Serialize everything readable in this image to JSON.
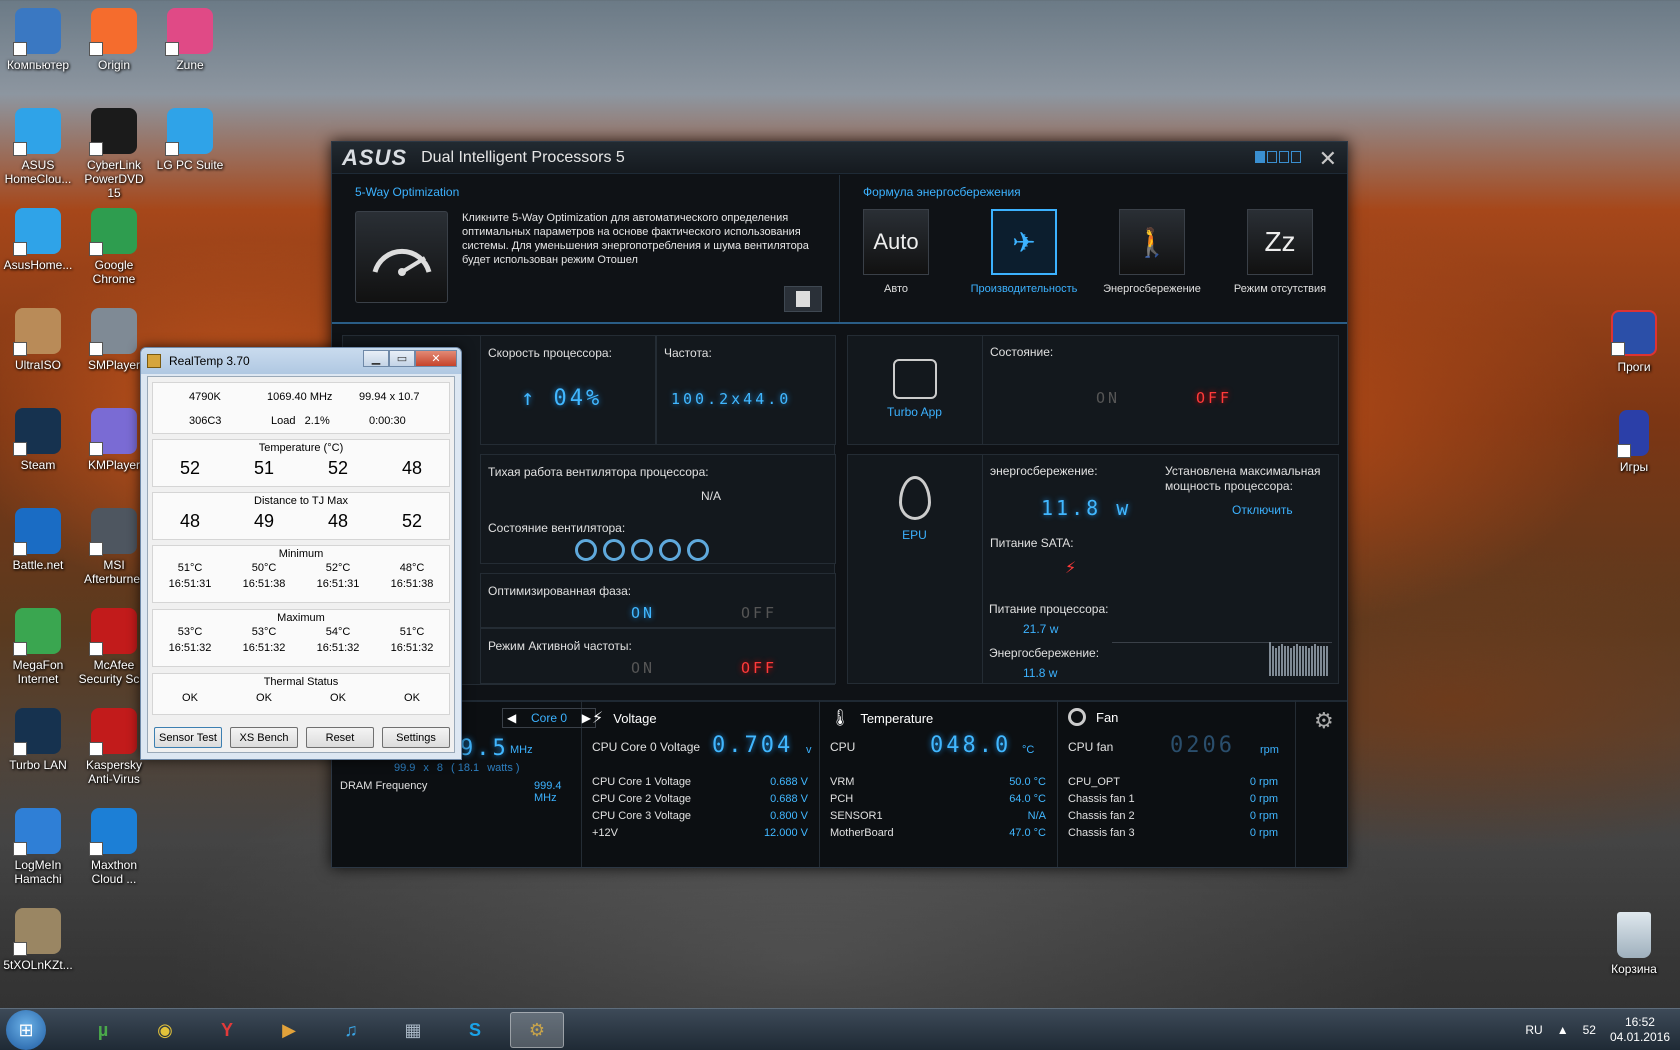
{
  "desktop_left": [
    {
      "label": "Компьютер",
      "icon": "computer-icon",
      "color": "#3a78c2"
    },
    {
      "label": "Origin",
      "icon": "origin-icon",
      "color": "#f56c2d"
    },
    {
      "label": "Zune",
      "icon": "zune-icon",
      "color": "#e04a86"
    },
    {
      "label": "ASUS HomeClou...",
      "icon": "cloud-icon",
      "color": "#2fa3e8"
    },
    {
      "label": "CyberLink PowerDVD 15",
      "icon": "powerdvd-icon",
      "color": "#1b1b1b"
    },
    {
      "label": "LG PC Suite",
      "icon": "lg-icon",
      "color": "#2fa3e8"
    },
    {
      "label": "AsusHome...",
      "icon": "cloud-icon",
      "color": "#2fa3e8"
    },
    {
      "label": "Google Chrome",
      "icon": "chrome-icon",
      "color": "#2e9d4f"
    },
    {
      "label": "UltraISO",
      "icon": "disc-icon",
      "color": "#b98b58"
    },
    {
      "label": "SMPlayer",
      "icon": "film-icon",
      "color": "#7f8a95"
    },
    {
      "label": "Steam",
      "icon": "steam-icon",
      "color": "#16324f"
    },
    {
      "label": "KMPlayer",
      "icon": "play-icon",
      "color": "#7a6bd4"
    },
    {
      "label": "Battle.net",
      "icon": "battlenet-icon",
      "color": "#1a6cc4"
    },
    {
      "label": "MSI Afterburner",
      "icon": "jet-icon",
      "color": "#4e5660"
    },
    {
      "label": "MegaFon Internet",
      "icon": "signal-icon",
      "color": "#3aa650"
    },
    {
      "label": "McAfee Security Sc...",
      "icon": "mcafee-icon",
      "color": "#c21b1b"
    },
    {
      "label": "Turbo LAN",
      "icon": "globe-icon",
      "color": "#16324f"
    },
    {
      "label": "Kaspersky Anti-Virus",
      "icon": "kaspersky-icon",
      "color": "#c21b1b"
    },
    {
      "label": "LogMeIn Hamachi",
      "icon": "hamachi-icon",
      "color": "#2f7fd6"
    },
    {
      "label": "Maxthon Cloud ...",
      "icon": "maxthon-icon",
      "color": "#1c7fd6"
    },
    {
      "label": "5tXOLnKZt...",
      "icon": "image-icon",
      "color": "#9a8663"
    }
  ],
  "desktop_right": [
    {
      "label": "Проги",
      "icon": "folder-icon"
    },
    {
      "label": "Игры",
      "icon": "book-icon"
    },
    {
      "label": "Корзина",
      "icon": "recycle-bin-icon"
    }
  ],
  "asus": {
    "logo": "ASUS",
    "title": "Dual Intelligent Processors 5",
    "five_way": {
      "header": "5-Way Optimization",
      "description": "Кликните 5-Way Optimization для автоматического определения оптимальных параметров на основе фактического использования системы. Для уменьшения энергопотребления и шума вентилятора будет использован режим Отошел"
    },
    "formula": {
      "header": "Формула энергосбережения",
      "modes": [
        {
          "icon_text": "Auto",
          "label": "Авто",
          "active": false
        },
        {
          "icon_text": "✈",
          "label": "Производительность",
          "active": true
        },
        {
          "icon_text": "🚶",
          "label": "Энергосбережение",
          "active": false
        },
        {
          "icon_text": "Zz",
          "label": "Режим отсутствия",
          "active": false
        }
      ]
    },
    "tpu": {
      "cpu_speed_label": "Скорость процессора:",
      "cpu_speed_value": "04%",
      "freq_label": "Частота:",
      "freq_value": "100.2x44.0",
      "fan_quiet_label": "Тихая работа вентилятора процессора:",
      "fan_quiet_value": "N/A",
      "fan_state_label": "Состояние вентилятора:",
      "phase_label": "Оптимизированная фаза:",
      "phase_on": "ON",
      "phase_off": "OFF",
      "active_freq_label": "Режим Активной частоты:",
      "active_on": "ON",
      "active_off": "OFF"
    },
    "turbo_app": {
      "label": "Turbo App",
      "state_label": "Состояние:",
      "on": "ON",
      "off": "OFF"
    },
    "epu": {
      "label": "EPU",
      "saving_label": "энергосбережение:",
      "saving_value": "11.8 w",
      "max_power_label": "Установлена максимальная мощность процессора:",
      "disable_link": "Отключить",
      "sata_label": "Питание SATA:",
      "cpu_power_label": "Питание процессора:",
      "cpu_power_value": "21.7 w",
      "energy_label": "Энергосбережение:",
      "energy_value": "11.8 w"
    },
    "monitor": {
      "core_selector": "Core 0",
      "freq_big": "9.5",
      "freq_unit": "MHz",
      "freq_sub_a": "99.9",
      "freq_sub_x": "x",
      "freq_sub_b": "8",
      "freq_sub_c": "( 18.1",
      "freq_sub_d": "watts )",
      "dram_label": "DRAM Frequency",
      "dram_value": "999.4 MHz",
      "voltage": {
        "title": "Voltage",
        "main_label": "CPU Core 0 Voltage",
        "main_value": "0.704",
        "main_unit": "v",
        "rows": [
          {
            "name": "CPU Core 1 Voltage",
            "value": "0.688",
            "unit": "V"
          },
          {
            "name": "CPU Core 2 Voltage",
            "value": "0.688",
            "unit": "V"
          },
          {
            "name": "CPU Core 3 Voltage",
            "value": "0.800",
            "unit": "V"
          },
          {
            "name": "+12V",
            "value": "12.000",
            "unit": "V"
          }
        ]
      },
      "temperature": {
        "title": "Temperature",
        "main_label": "CPU",
        "main_value": "048.0",
        "main_unit": "°C",
        "rows": [
          {
            "name": "VRM",
            "value": "50.0 °C"
          },
          {
            "name": "PCH",
            "value": "64.0 °C"
          },
          {
            "name": "SENSOR1",
            "value": "N/A"
          },
          {
            "name": "MotherBoard",
            "value": "47.0 °C"
          }
        ]
      },
      "fan": {
        "title": "Fan",
        "main_label": "CPU fan",
        "main_value": "0206",
        "main_unit": "rpm",
        "rows": [
          {
            "name": "CPU_OPT",
            "value": "0",
            "unit": "rpm"
          },
          {
            "name": "Chassis fan 1",
            "value": "0",
            "unit": "rpm"
          },
          {
            "name": "Chassis fan 2",
            "value": "0",
            "unit": "rpm"
          },
          {
            "name": "Chassis fan 3",
            "value": "0",
            "unit": "rpm"
          }
        ]
      }
    }
  },
  "realtemp": {
    "title": "RealTemp 3.70",
    "cpu_model": "4790K",
    "cpu_freq": "1069.40 MHz",
    "multiplier": "99.94 x 10.7",
    "cpuid": "306C3",
    "load_label": "Load",
    "load_value": "2.1%",
    "elapsed": "0:00:30",
    "temp_caption": "Temperature (°C)",
    "temps": [
      "52",
      "51",
      "52",
      "48"
    ],
    "tjmax_caption": "Distance to TJ Max",
    "tjmax": [
      "48",
      "49",
      "48",
      "52"
    ],
    "min_caption": "Minimum",
    "min_temps": [
      "51°C",
      "50°C",
      "52°C",
      "48°C"
    ],
    "min_times": [
      "16:51:31",
      "16:51:38",
      "16:51:31",
      "16:51:38"
    ],
    "max_caption": "Maximum",
    "max_temps": [
      "53°C",
      "53°C",
      "54°C",
      "51°C"
    ],
    "max_times": [
      "16:51:32",
      "16:51:32",
      "16:51:32",
      "16:51:32"
    ],
    "thermal_caption": "Thermal Status",
    "thermal": [
      "OK",
      "OK",
      "OK",
      "OK"
    ],
    "buttons": [
      "Sensor Test",
      "XS Bench",
      "Reset",
      "Settings"
    ]
  },
  "taskbar": {
    "apps": [
      {
        "name": "utorrent",
        "glyph": "µ",
        "color": "#4aa84a"
      },
      {
        "name": "chrome",
        "glyph": "◉",
        "color": "#e2c23a"
      },
      {
        "name": "yandex",
        "glyph": "Y",
        "color": "#e23a3a"
      },
      {
        "name": "media-player",
        "glyph": "▶",
        "color": "#e2a23a"
      },
      {
        "name": "itunes",
        "glyph": "♫",
        "color": "#3aa3e2"
      },
      {
        "name": "calculator",
        "glyph": "▦",
        "color": "#a8b6c4"
      },
      {
        "name": "skype",
        "glyph": "S",
        "color": "#1aa3e8"
      },
      {
        "name": "asus-dip",
        "glyph": "⚙",
        "color": "#c8a44a"
      }
    ],
    "lang": "RU",
    "tray_num": "52",
    "time": "16:52",
    "date": "04.01.2016"
  }
}
